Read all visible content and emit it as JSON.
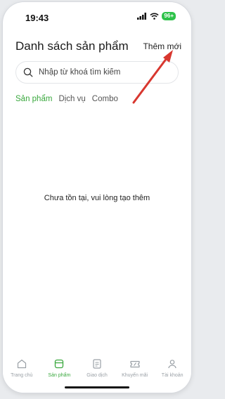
{
  "status_bar": {
    "time": "19:43",
    "battery": "96+"
  },
  "header": {
    "title": "Danh sách sản phẩm",
    "add_new_label": "Thêm mới"
  },
  "search": {
    "placeholder": "Nhập từ khoá tìm kiếm",
    "value": ""
  },
  "tabs": [
    {
      "label": "Sản phẩm",
      "active": true
    },
    {
      "label": "Dịch vụ",
      "active": false
    },
    {
      "label": "Combo",
      "active": false
    }
  ],
  "empty_state": {
    "message": "Chưa tồn tại, vui lòng tạo thêm"
  },
  "bottom_nav": [
    {
      "label": "Trang chủ",
      "icon": "home-icon",
      "active": false
    },
    {
      "label": "Sản phẩm",
      "icon": "product-icon",
      "active": true
    },
    {
      "label": "Giao dịch",
      "icon": "transaction-icon",
      "active": false
    },
    {
      "label": "Khuyến mãi",
      "icon": "promotion-icon",
      "active": false
    },
    {
      "label": "Tài khoản",
      "icon": "account-icon",
      "active": false
    }
  ],
  "colors": {
    "accent": "#39a83d",
    "annotation_arrow": "#d8372f",
    "battery": "#2ec24a"
  }
}
